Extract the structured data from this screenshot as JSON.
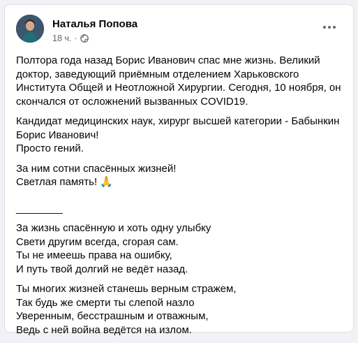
{
  "post": {
    "author": "Наталья Попова",
    "time": "18 ч.",
    "dot": "·",
    "paragraphs": [
      [
        "Полтора года назад Борис Иванович спас мне жизнь. Великий",
        "доктор, заведующий приёмным отделением Харьковского",
        "Института Общей и Неотложной Хирургии. Сегодня, 10 ноября, он",
        "скончался от осложнений вызванных COVID19."
      ],
      [
        "Кандидат медицинских наук, хирург высшей категории - Бабынкин",
        "Борис Иванович!",
        "Просто гений."
      ],
      [
        "За ним сотни спасённых жизней!",
        "Светлая память! 🙏"
      ],
      [
        "________"
      ],
      [
        "За жизнь спасённую и хоть одну улыбку",
        "Свети другим всегда, сгорая сам.",
        "Ты не имеешь права на ошибку,",
        "И путь твой долгий не ведёт назад."
      ],
      [
        "Ты многих жизней станешь верным стражем,",
        "Так будь же смерти ты слепой назло",
        "Уверенным, бесстрашным и отважным,",
        "Ведь с ней война ведётся на излом."
      ]
    ]
  },
  "icons": {
    "more": "more-options-icon",
    "audience": "globe-icon"
  },
  "colors": {
    "background": "#f0f2f5",
    "card": "#ffffff",
    "text": "#050505",
    "secondary": "#65676b"
  }
}
